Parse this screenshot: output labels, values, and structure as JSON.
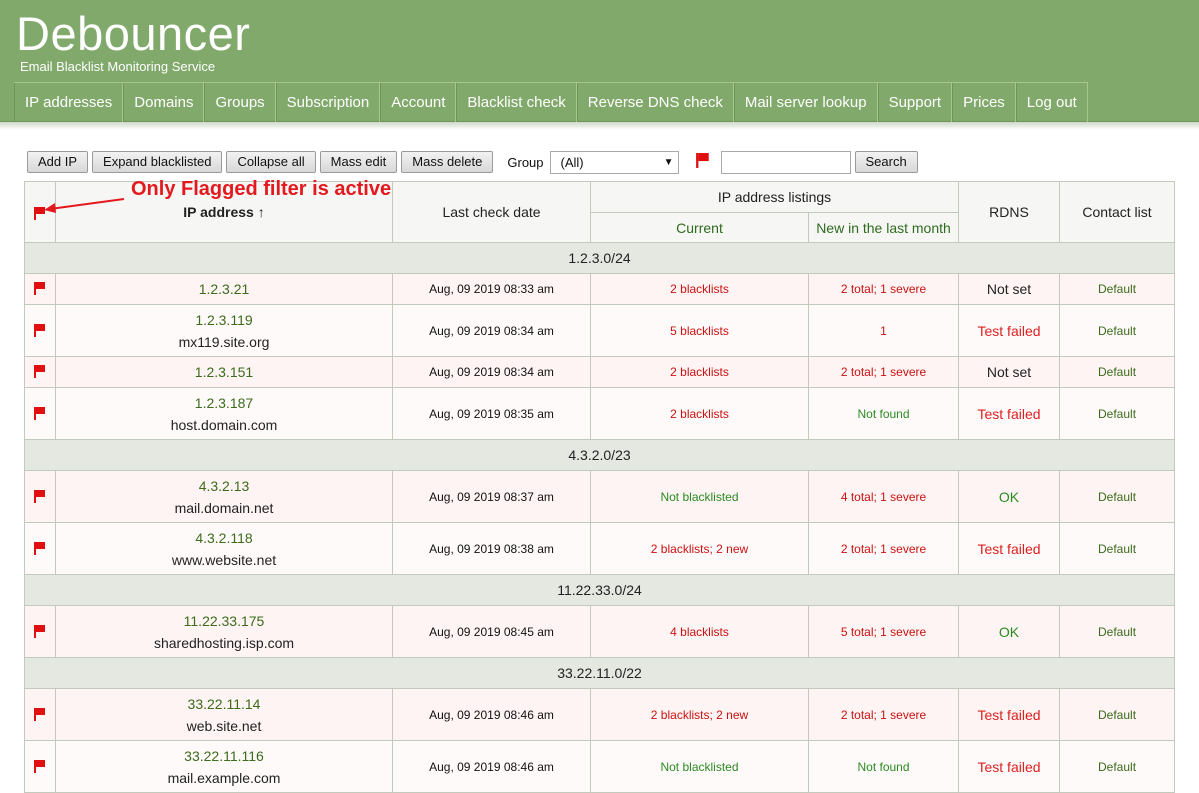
{
  "app": {
    "title": "Debouncer",
    "subtitle": "Email Blacklist Monitoring Service"
  },
  "nav": [
    {
      "label": "IP addresses"
    },
    {
      "label": "Domains"
    },
    {
      "label": "Groups"
    },
    {
      "label": "Subscription"
    },
    {
      "label": "Account"
    },
    {
      "label": "Blacklist check"
    },
    {
      "label": "Reverse DNS check"
    },
    {
      "label": "Mail server lookup"
    },
    {
      "label": "Support"
    },
    {
      "label": "Prices"
    },
    {
      "label": "Log out"
    }
  ],
  "toolbar": {
    "add_ip": "Add IP",
    "expand_blacklisted": "Expand blacklisted",
    "collapse_all": "Collapse all",
    "mass_edit": "Mass edit",
    "mass_delete": "Mass delete",
    "group_label": "Group",
    "group_value": "(All)",
    "search_value": "",
    "search_button": "Search",
    "flag_icon": "flag-icon",
    "flag_color": "#e01010"
  },
  "annotation": "Only Flagged filter is active",
  "table": {
    "headers": {
      "ip": "IP address ↑",
      "last_check": "Last check date",
      "listings": "IP address listings",
      "current": "Current",
      "new_month": "New in the last month",
      "rdns": "RDNS",
      "contact": "Contact list"
    },
    "groups": [
      {
        "name": "1.2.3.0/24",
        "rows": [
          {
            "ip": "1.2.3.21",
            "host": "",
            "date": "Aug, 09 2019 08:33 am",
            "current": "2 blacklists",
            "current_status": "red",
            "new": "2 total; 1 severe",
            "new_status": "red",
            "rdns": "Not set",
            "rdns_status": "plain",
            "contact": "Default"
          },
          {
            "ip": "1.2.3.119",
            "host": "mx119.site.org",
            "date": "Aug, 09 2019 08:34 am",
            "current": "5 blacklists",
            "current_status": "red",
            "new": "1",
            "new_status": "red",
            "rdns": "Test failed",
            "rdns_status": "red",
            "contact": "Default"
          },
          {
            "ip": "1.2.3.151",
            "host": "",
            "date": "Aug, 09 2019 08:34 am",
            "current": "2 blacklists",
            "current_status": "red",
            "new": "2 total; 1 severe",
            "new_status": "red",
            "rdns": "Not set",
            "rdns_status": "plain",
            "contact": "Default"
          },
          {
            "ip": "1.2.3.187",
            "host": "host.domain.com",
            "date": "Aug, 09 2019 08:35 am",
            "current": "2 blacklists",
            "current_status": "red",
            "new": "Not found",
            "new_status": "green",
            "rdns": "Test failed",
            "rdns_status": "red",
            "contact": "Default"
          }
        ]
      },
      {
        "name": "4.3.2.0/23",
        "rows": [
          {
            "ip": "4.3.2.13",
            "host": "mail.domain.net",
            "date": "Aug, 09 2019 08:37 am",
            "current": "Not blacklisted",
            "current_status": "green",
            "new": "4 total; 1 severe",
            "new_status": "red",
            "rdns": "OK",
            "rdns_status": "green",
            "contact": "Default"
          },
          {
            "ip": "4.3.2.118",
            "host": "www.website.net",
            "date": "Aug, 09 2019 08:38 am",
            "current": "2 blacklists; 2 new",
            "current_status": "red",
            "new": "2 total; 1 severe",
            "new_status": "red",
            "rdns": "Test failed",
            "rdns_status": "red",
            "contact": "Default"
          }
        ]
      },
      {
        "name": "11.22.33.0/24",
        "rows": [
          {
            "ip": "11.22.33.175",
            "host": "sharedhosting.isp.com",
            "date": "Aug, 09 2019 08:45 am",
            "current": "4 blacklists",
            "current_status": "red",
            "new": "5 total; 1 severe",
            "new_status": "red",
            "rdns": "OK",
            "rdns_status": "green",
            "contact": "Default"
          }
        ]
      },
      {
        "name": "33.22.11.0/22",
        "rows": [
          {
            "ip": "33.22.11.14",
            "host": "web.site.net",
            "date": "Aug, 09 2019 08:46 am",
            "current": "2 blacklists; 2 new",
            "current_status": "red",
            "new": "2 total; 1 severe",
            "new_status": "red",
            "rdns": "Test failed",
            "rdns_status": "red",
            "contact": "Default"
          },
          {
            "ip": "33.22.11.116",
            "host": "mail.example.com",
            "date": "Aug, 09 2019 08:46 am",
            "current": "Not blacklisted",
            "current_status": "green",
            "new": "Not found",
            "new_status": "green",
            "rdns": "Test failed",
            "rdns_status": "red",
            "contact": "Default"
          }
        ]
      }
    ]
  }
}
